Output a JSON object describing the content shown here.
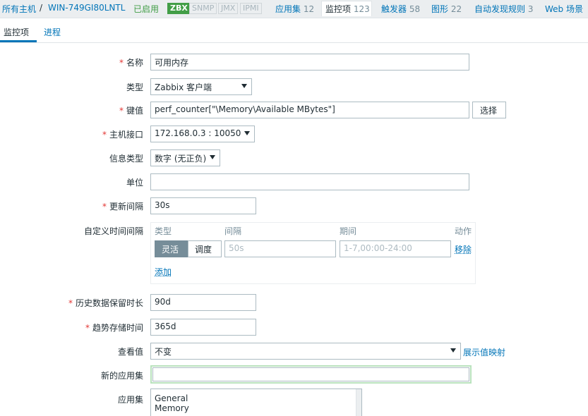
{
  "breadcrumb": {
    "all_hosts": "所有主机",
    "separator": "/",
    "host": "WIN-749GI80LNTL",
    "status": "已启用"
  },
  "availability": {
    "zbx": "ZBX",
    "snmp": "SNMP",
    "jmx": "JMX",
    "ipmi": "IPMI"
  },
  "host_nav": [
    {
      "label": "应用集",
      "count": "12"
    },
    {
      "label": "监控项",
      "count": "123"
    },
    {
      "label": "触发器",
      "count": "58"
    },
    {
      "label": "图形",
      "count": "22"
    },
    {
      "label": "自动发现规则",
      "count": "3"
    },
    {
      "label": "Web 场景",
      "count": ""
    }
  ],
  "tabs": {
    "item": "监控项",
    "process": "进程"
  },
  "form": {
    "name": {
      "label": "名称",
      "value": "可用内存"
    },
    "type": {
      "label": "类型",
      "value": "Zabbix 客户端"
    },
    "key": {
      "label": "键值",
      "value": "perf_counter[\"\\Memory\\Available MBytes\"]",
      "button": "选择"
    },
    "interface": {
      "label": "主机接口",
      "value": "172.168.0.3 : 10050"
    },
    "info_type": {
      "label": "信息类型",
      "value": "数字 (无正负)"
    },
    "units": {
      "label": "单位",
      "value": ""
    },
    "update_interval": {
      "label": "更新间隔",
      "value": "30s"
    },
    "custom_intervals": {
      "label": "自定义时间间隔",
      "headers": {
        "type": "类型",
        "interval": "间隔",
        "period": "期间",
        "action": "动作"
      },
      "flexible": "灵活",
      "scheduling": "调度",
      "interval_placeholder": "50s",
      "period_placeholder": "1-7,00:00-24:00",
      "remove": "移除",
      "add": "添加"
    },
    "history": {
      "label": "历史数据保留时长",
      "value": "90d"
    },
    "trends": {
      "label": "趋势存储时间",
      "value": "365d"
    },
    "valuemap": {
      "label": "查看值",
      "value": "不变",
      "link": "展示值映射"
    },
    "new_application": {
      "label": "新的应用集",
      "value": ""
    },
    "applications": {
      "label": "应用集",
      "options": [
        "General",
        "Memory"
      ]
    }
  },
  "colors": {
    "link": "#0275b8",
    "enabled": "#429e47",
    "required": "#e33734"
  }
}
